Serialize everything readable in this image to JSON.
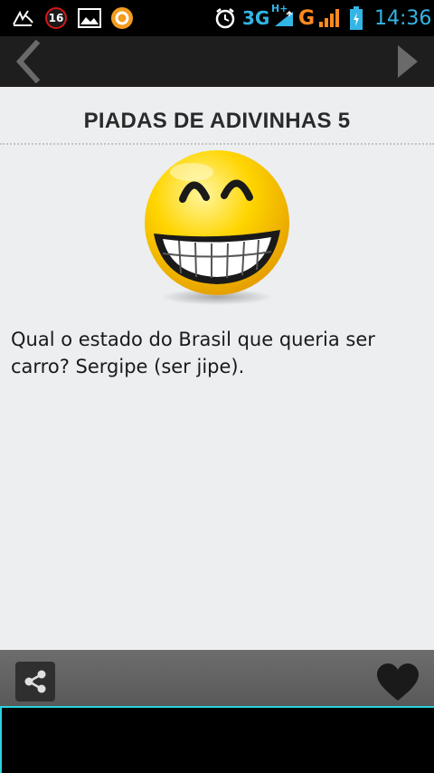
{
  "status_bar": {
    "notification_count": "16",
    "network_3g": "3G",
    "network_hplus": "H+",
    "network_g": "G",
    "time": "14:36"
  },
  "page": {
    "title": "PIADAS DE ADIVINHAS 5",
    "joke_text": "Qual o estado do Brasil que queria ser carro? Sergipe (ser jipe)."
  },
  "icons": {
    "back": "chevron-left-icon",
    "forward": "play-forward-icon",
    "share": "share-icon",
    "favorite": "heart-icon",
    "emoji": "grinning-face-icon"
  },
  "colors": {
    "status_accent": "#33b5e5",
    "ad_border": "#2bd4dc",
    "content_background": "#eceef0"
  }
}
